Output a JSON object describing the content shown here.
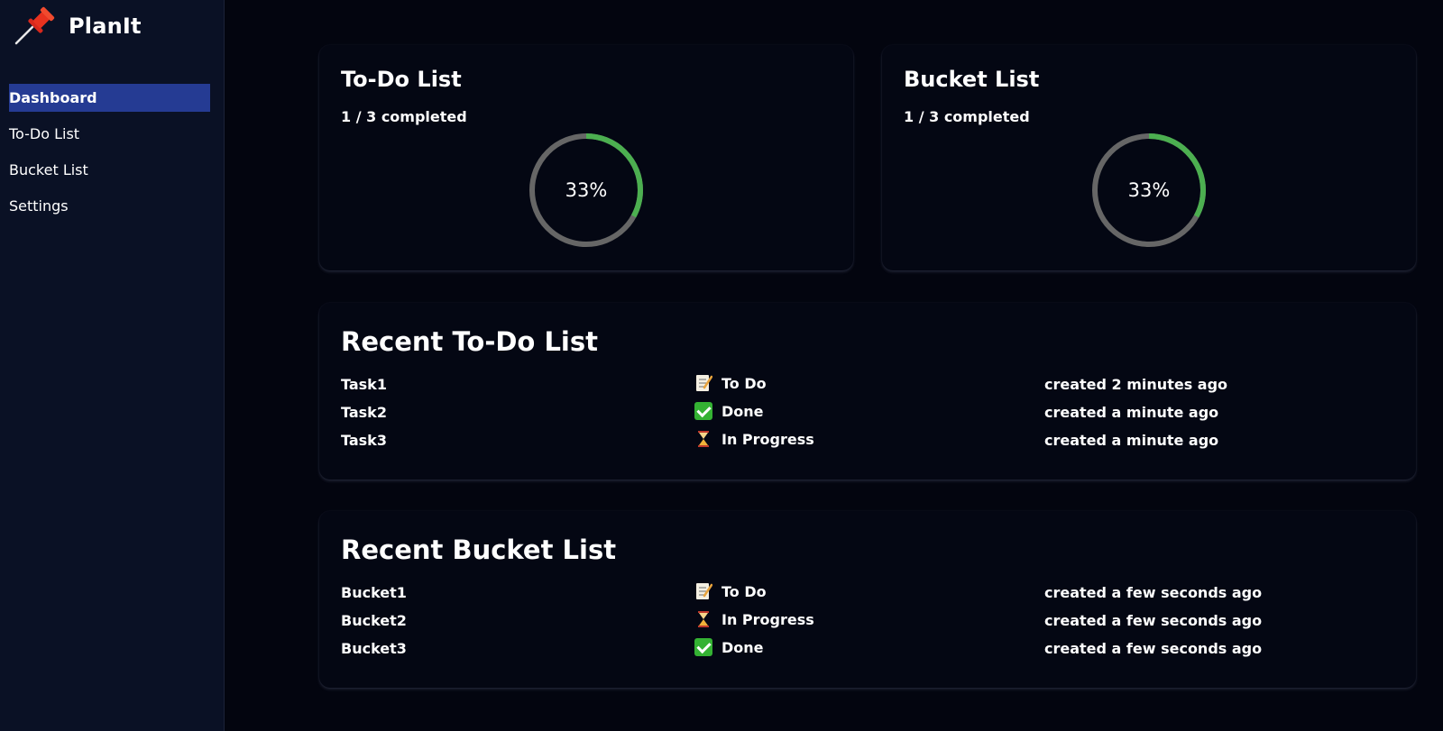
{
  "app": {
    "name": "PlanIt",
    "logo_icon": "pushpin-icon"
  },
  "sidebar": {
    "items": [
      {
        "label": "Dashboard",
        "active": true
      },
      {
        "label": "To-Do List",
        "active": false
      },
      {
        "label": "Bucket List",
        "active": false
      },
      {
        "label": "Settings",
        "active": false
      }
    ]
  },
  "colors": {
    "accent_nav": "#253b93",
    "progress": "#4caf50",
    "track": "#666666",
    "background": "#03050f"
  },
  "todo_summary": {
    "title": "To-Do List",
    "completed_text": "1 / 3 completed",
    "percent_label": "33%",
    "percent": 33
  },
  "bucket_summary": {
    "title": "Bucket List",
    "completed_text": "1 / 3 completed",
    "percent_label": "33%",
    "percent": 33
  },
  "recent_todo": {
    "title": "Recent To-Do List",
    "rows": [
      {
        "name": "Task1",
        "status": "To Do",
        "status_icon": "memo-icon",
        "created": "created 2 minutes ago"
      },
      {
        "name": "Task2",
        "status": "Done",
        "status_icon": "check-icon",
        "created": "created a minute ago"
      },
      {
        "name": "Task3",
        "status": "In Progress",
        "status_icon": "hourglass-icon",
        "created": "created a minute ago"
      }
    ]
  },
  "recent_bucket": {
    "title": "Recent Bucket List",
    "rows": [
      {
        "name": "Bucket1",
        "status": "To Do",
        "status_icon": "memo-icon",
        "created": "created a few seconds ago"
      },
      {
        "name": "Bucket2",
        "status": "In Progress",
        "status_icon": "hourglass-icon",
        "created": "created a few seconds ago"
      },
      {
        "name": "Bucket3",
        "status": "Done",
        "status_icon": "check-icon",
        "created": "created a few seconds ago"
      }
    ]
  }
}
